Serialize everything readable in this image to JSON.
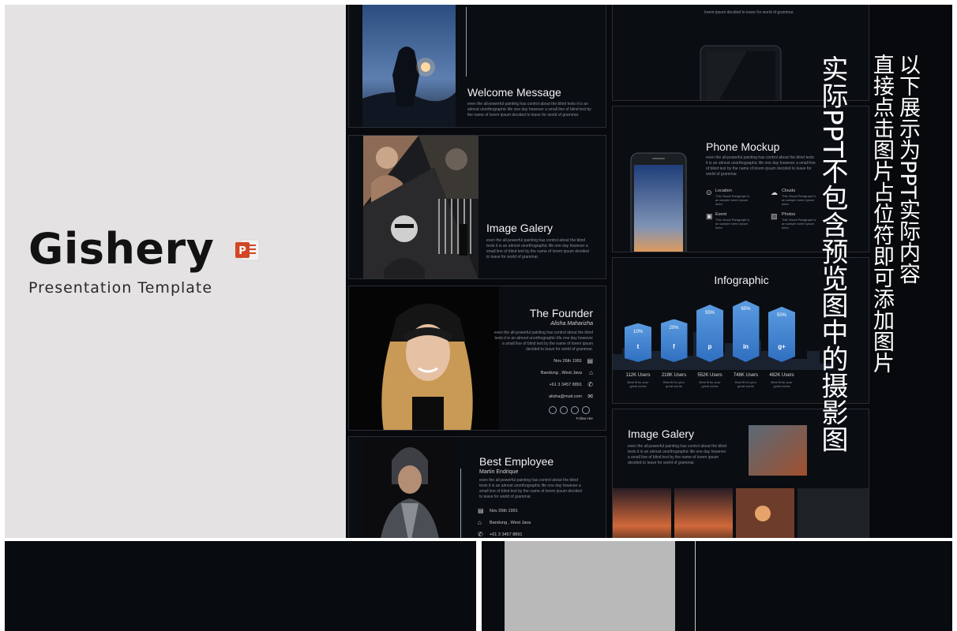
{
  "cover": {
    "title": "Gishery",
    "subtitle": "Presentation Template",
    "ppt_icon_letter": "P",
    "ppt_color": "#d24726"
  },
  "slides": {
    "welcome": {
      "title": "Welcome Message",
      "body": "even the all-powerful painting has control about the blind texts it is an almost unorthographic life one day however a small line of blind text by the name of lorem ipsum decided to leave for world of grammar."
    },
    "tablet": {
      "body": "lorem ipsum decided to leave for world of grammar."
    },
    "phone": {
      "title": "Phone Mockup",
      "body": "even the all-powerful painting has control about the blind texts it is an almost unorthographic life one day however a small line of blind text by the name of lorem ipsum decided to leave for world of grammar.",
      "features": [
        {
          "icon": "location-icon",
          "label": "Location",
          "text": "This Visual Paragraph is an sample lorem ipsum dolor"
        },
        {
          "icon": "cloud-icon",
          "label": "Clouds",
          "text": "This Visual Paragraph is an sample lorem ipsum dolor"
        },
        {
          "icon": "calendar-icon",
          "label": "Event",
          "text": "This Visual Paragraph is an sample lorem ipsum dolor"
        },
        {
          "icon": "image-icon",
          "label": "Photos",
          "text": "This Visual Paragraph is an sample lorem ipsum dolor"
        }
      ]
    },
    "galery1": {
      "title": "Image Galery",
      "body": "even the all-powerful painting has control about the blind texts it is an almost unorthographic life one day however a small line of blind text by the name of lorem ipsum decided to leave for world of grammar."
    },
    "infographic": {
      "title": "Infographic",
      "columns": [
        {
          "value": "10%",
          "icon": "twitter-icon",
          "glyph": "t",
          "users": "112K Users",
          "note": "Best fit for your great words"
        },
        {
          "value": "20%",
          "icon": "facebook-icon",
          "glyph": "f",
          "users": "218K Users",
          "note": "Best fit for your great words"
        },
        {
          "value": "55%",
          "icon": "pinterest-icon",
          "glyph": "p",
          "users": "552K Users",
          "note": "Best fit for your great words"
        },
        {
          "value": "65%",
          "icon": "linkedin-icon",
          "glyph": "in",
          "users": "748K Users",
          "note": "Best fit for your great words"
        },
        {
          "value": "50%",
          "icon": "googleplus-icon",
          "glyph": "g+",
          "users": "482K Users",
          "note": "Best fit for your great words"
        }
      ]
    },
    "founder": {
      "title": "The Founder",
      "name": "Alisha Maharizha",
      "body": "even the all-powerful painting has control about the blind texts it is an almost unorthographic life one day however a small line of blind text by the name of lorem ipsum decided to leave for world of grammar.",
      "date": "Nov 26th 1991",
      "location": "Bandung , West Java",
      "phone": "+61 3 3457 8891",
      "email": "alisha@mail.com",
      "follow": "Follow Her"
    },
    "galery2": {
      "title": "Image Galery",
      "body": "even the all-powerful painting has control about the blind texts it is an almost unorthographic life one day however a small line of blind text by the name of lorem ipsum decided to leave for world of grammar."
    },
    "employee": {
      "title": "Best Employee",
      "name": "Martin Endrique",
      "body": "even the all-powerful painting has control about the blind texts it is an almost unorthographic life one day however a small line of blind text by the name of lorem ipsum decided to leave for world of grammar.",
      "date": "Nov 26th 1991",
      "location": "Bandung , West Java",
      "phone": "+61 3 3457 8891"
    }
  },
  "notes": {
    "left": "实际PPT不包含预览图中的摄影图",
    "right_line1": "以下展示为PPT实际内容",
    "right_line2": "直接点击图片占位符即可添加图片"
  }
}
